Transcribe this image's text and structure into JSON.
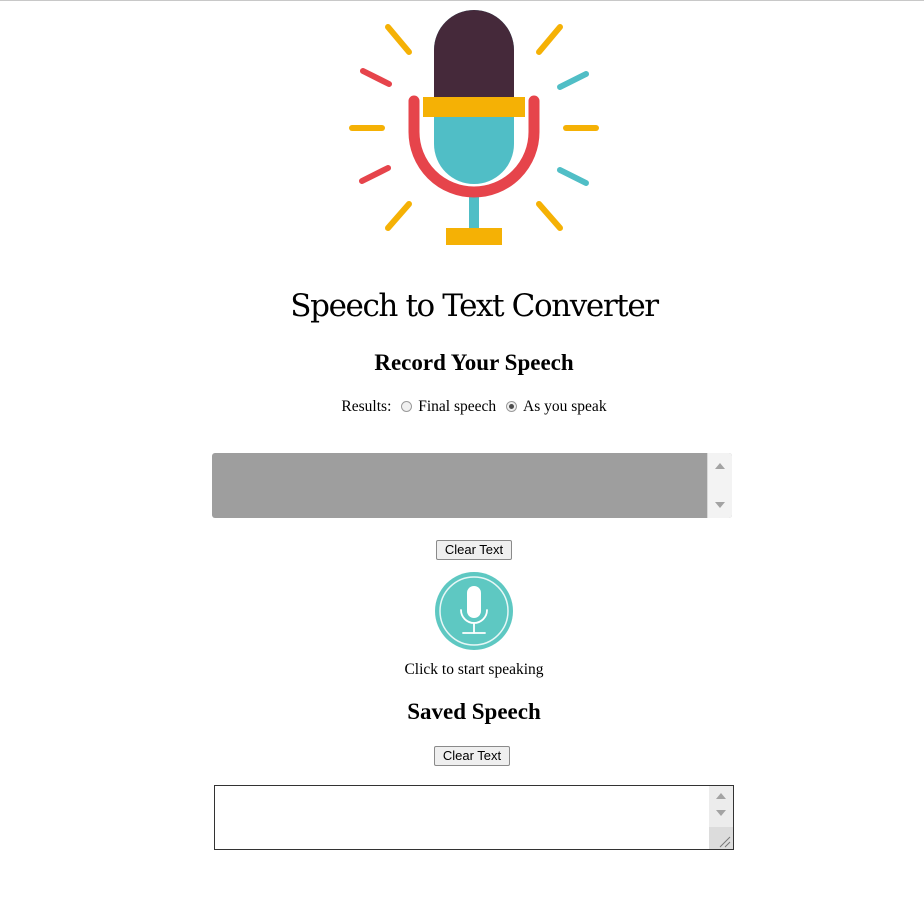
{
  "app": {
    "title": "Speech to Text Converter"
  },
  "record": {
    "heading": "Record Your Speech",
    "results_label": "Results:",
    "options": [
      {
        "label": "Final speech",
        "selected": false
      },
      {
        "label": "As you speak",
        "selected": true
      }
    ],
    "transcript_value": "",
    "clear_label": "Clear Text",
    "mic_caption": "Click to start speaking"
  },
  "saved": {
    "heading": "Saved Speech",
    "clear_label": "Clear Text",
    "saved_value": ""
  },
  "icons": {
    "hero": "microphone-logo-icon",
    "record": "microphone-icon"
  },
  "colors": {
    "mic_head": "#45293a",
    "mic_band": "#f5b105",
    "mic_body": "#50bec6",
    "mic_holder": "#e6444b",
    "record_button": "#5ec8c2",
    "live_area_bg": "#9e9e9e"
  }
}
